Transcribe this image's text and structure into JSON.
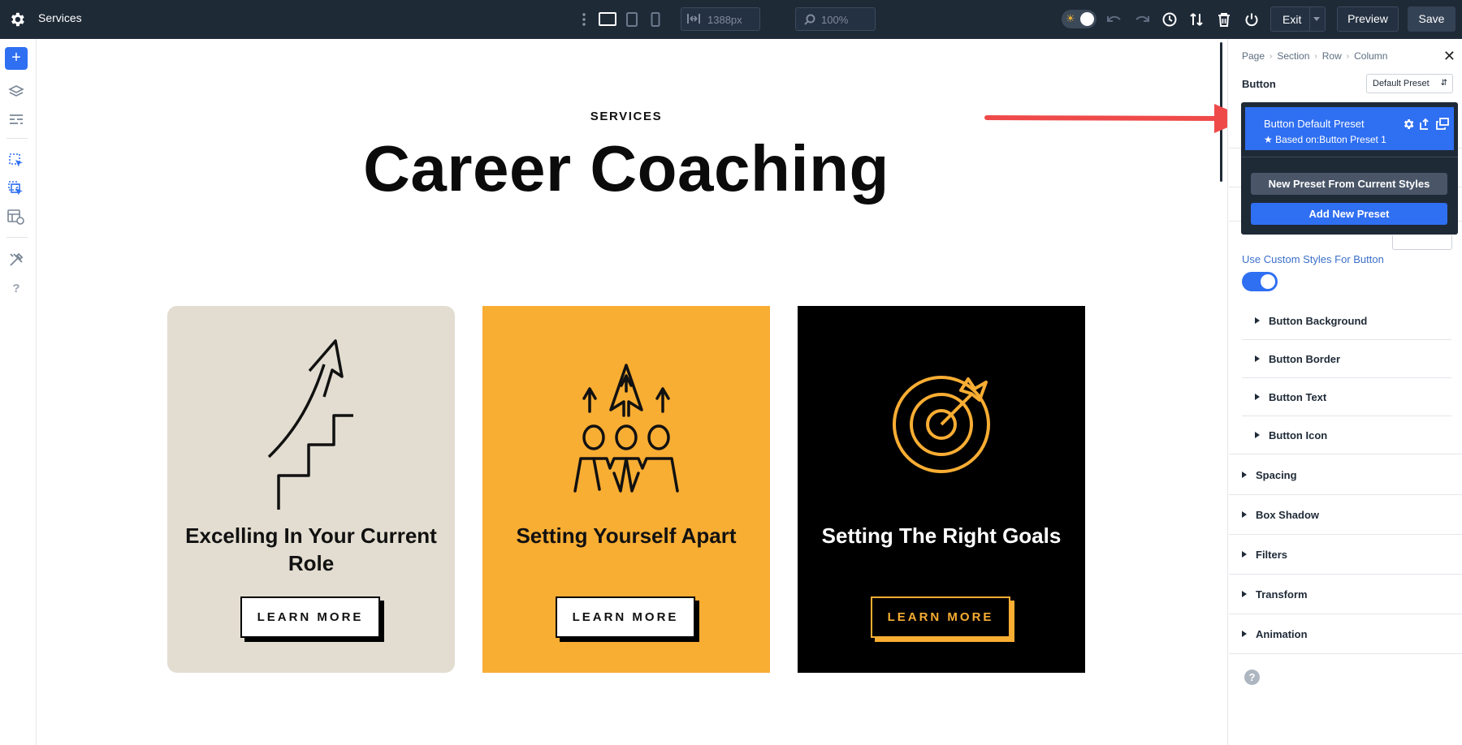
{
  "topbar": {
    "title": "Services",
    "width_value": "1388px",
    "zoom_value": "100%",
    "exit_label": "Exit",
    "preview_label": "Preview",
    "save_label": "Save"
  },
  "canvas": {
    "eyebrow": "SERVICES",
    "heading": "Career Coaching",
    "cards": [
      {
        "title": "Excelling In Your Current Role",
        "button": "LEARN MORE",
        "icon": "stairs-arrow-icon",
        "background": "#e3ddd1"
      },
      {
        "title": "Setting Yourself Apart",
        "button": "LEARN MORE",
        "icon": "team-arrows-icon",
        "background": "#f8ad33"
      },
      {
        "title": "Setting The Right Goals",
        "button": "LEARN MORE",
        "icon": "target-icon",
        "background": "#000000"
      }
    ]
  },
  "panel": {
    "breadcrumb": [
      "Page",
      "Section",
      "Row",
      "Column"
    ],
    "module_title": "Button",
    "preset_select": "Default Preset",
    "preset_popover": {
      "active_preset": "Button Default Preset",
      "based_on": "Based on:Button Preset 1",
      "new_from_current": "New Preset From Current Styles",
      "add_new": "Add New Preset"
    },
    "custom_styles_label": "Use Custom Styles For Button",
    "custom_styles_enabled": true,
    "button_settings": [
      "Button Background",
      "Button Border",
      "Button Text",
      "Button Icon"
    ],
    "groups": [
      "Spacing",
      "Box Shadow",
      "Filters",
      "Transform",
      "Animation"
    ]
  },
  "colors": {
    "accent": "#2f6ff2",
    "topbar": "#1f2a37",
    "annotation_arrow": "#ef4a4a",
    "orange": "#f8ad33"
  }
}
